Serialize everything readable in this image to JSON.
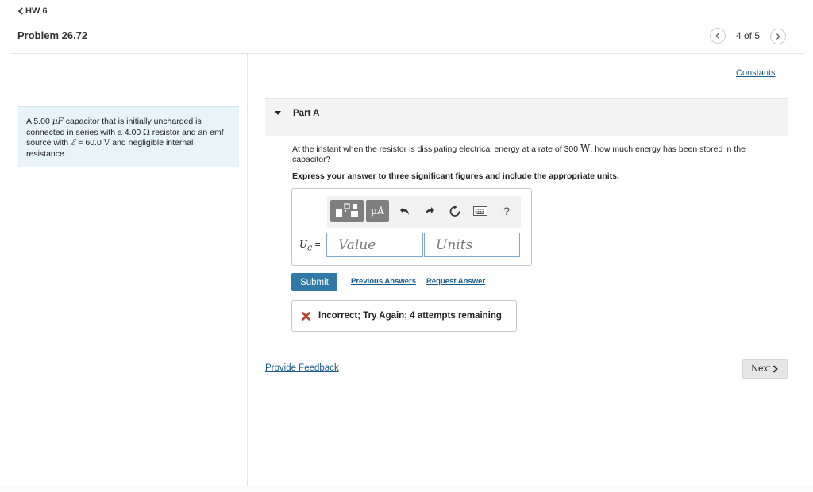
{
  "header": {
    "back_link": "HW 6",
    "problem_title": "Problem 26.72",
    "page_count": "4 of 5"
  },
  "problem": {
    "text_1": "A 5.00 ",
    "capacitance_unit": "μF",
    "text_2": " capacitor that is initially uncharged is connected in series with a 4.00 ",
    "resistance_unit": "Ω",
    "text_3": " resistor and an emf source with ",
    "emf_symbol": "ℰ",
    "text_4": " = 60.0 ",
    "voltage_unit": "V",
    "text_5": " and negligible internal resistance."
  },
  "constants_link": "Constants",
  "part": {
    "label": "Part A",
    "question_1": "At the instant when the resistor is dissipating electrical energy at a rate of 300 ",
    "power_unit": "W",
    "question_2": ", how much energy has been stored in the capacitor?",
    "instruction": "Express your answer to three significant figures and include the appropriate units."
  },
  "answer": {
    "variable_label": "U",
    "variable_sub": "C",
    "equals": " =",
    "value_placeholder": "Value",
    "units_placeholder": "Units",
    "units_tool_label": "μÅ",
    "help_label": "?"
  },
  "actions": {
    "submit_label": "Submit",
    "previous_answers": "Previous Answers",
    "request_answer": "Request Answer"
  },
  "feedback": {
    "message": "Incorrect; Try Again; 4 attempts remaining",
    "color": "#c0392b"
  },
  "footer": {
    "provide_feedback": "Provide Feedback",
    "next_label": "Next"
  },
  "colors": {
    "link": "#1a5a8a",
    "submit": "#3179a5",
    "problem_bg": "#e8f4f8"
  }
}
